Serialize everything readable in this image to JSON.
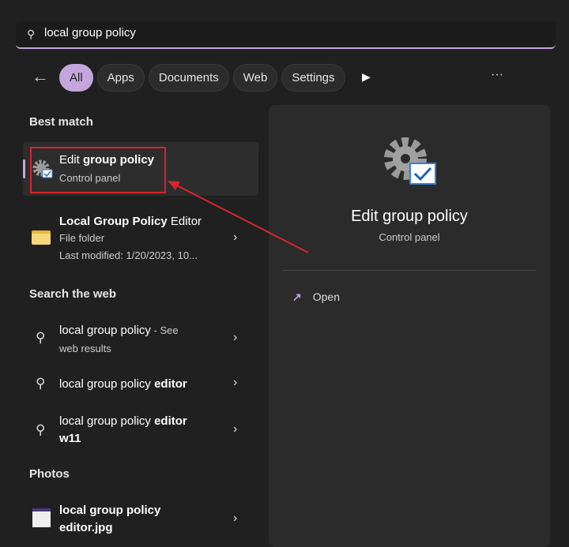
{
  "search": {
    "value": "local group policy",
    "icon": "search-icon"
  },
  "filters": {
    "back_icon": "arrow-left-icon",
    "pills": [
      "All",
      "Apps",
      "Documents",
      "Web",
      "Settings"
    ],
    "more_icon": "play-icon",
    "overflow_icon": "more-icon"
  },
  "best_match": {
    "heading": "Best match",
    "title_plain": "Edit ",
    "title_bold": "group policy",
    "subtitle": "Control panel"
  },
  "folder": {
    "title_bold": "Local Group Policy",
    "title_plain": " Editor",
    "type": "File folder",
    "modified": "Last modified: 1/20/2023, 10..."
  },
  "web": {
    "heading": "Search the web",
    "items": [
      {
        "plain": "local group policy",
        "suffix": " - See",
        "line2": "web results"
      },
      {
        "plain": "local group policy ",
        "bold": "editor"
      },
      {
        "plain": "local group policy ",
        "bold": "editor",
        "line2": "w11"
      }
    ]
  },
  "photos": {
    "heading": "Photos",
    "title": "local group policy",
    "line2": "editor.jpg"
  },
  "preview": {
    "title": "Edit group policy",
    "subtitle": "Control panel",
    "open_label": "Open"
  },
  "colors": {
    "accent": "#c4a6dc",
    "annotation": "#d9232f"
  }
}
